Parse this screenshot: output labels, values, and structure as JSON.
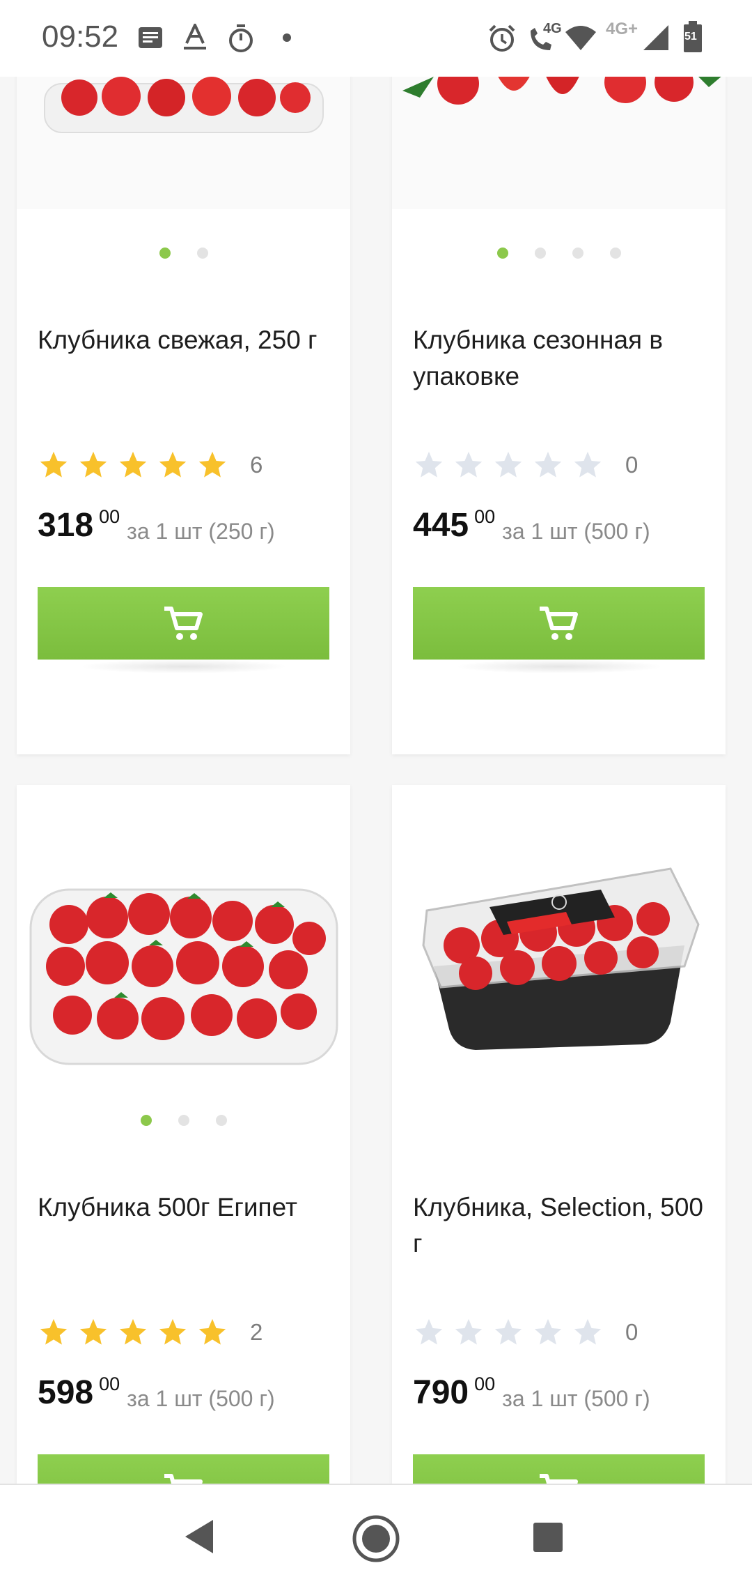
{
  "status_bar": {
    "time": "09:52",
    "icons": [
      "news-icon",
      "font-a-icon",
      "timer-icon",
      "dot-icon",
      "alarm-icon",
      "volte-4g-call-icon",
      "wifi-icon",
      "signal-4g-plus-icon",
      "battery-icon"
    ],
    "network_label": "4G+",
    "call_label": "4G",
    "battery_level": "51"
  },
  "products": [
    {
      "title": "Клубника свежая, 250 г",
      "rating_count": "6",
      "rating_stars": 5,
      "price_main": "318",
      "price_cents": "00",
      "price_unit": "за 1 шт (250 г)",
      "image_count": 2,
      "active_image": 0,
      "cart_icon": "cart-icon"
    },
    {
      "title": "Клубника сезонная в упаковке",
      "rating_count": "0",
      "rating_stars": 0,
      "price_main": "445",
      "price_cents": "00",
      "price_unit": "за 1 шт (500 г)",
      "image_count": 4,
      "active_image": 0,
      "cart_icon": "cart-icon"
    },
    {
      "title": "Клубника 500г Египет",
      "rating_count": "2",
      "rating_stars": 5,
      "price_main": "598",
      "price_cents": "00",
      "price_unit": "за 1 шт (500 г)",
      "image_count": 3,
      "active_image": 0,
      "cart_icon": "cart-icon"
    },
    {
      "title": "Клубника, Selection, 500 г",
      "rating_count": "0",
      "rating_stars": 0,
      "price_main": "790",
      "price_cents": "00",
      "price_unit": "за 1 шт (500 г)",
      "image_count": 1,
      "active_image": 0,
      "cart_icon": "cart-icon"
    }
  ],
  "colors": {
    "accent_green": "#8cc84b",
    "star_filled": "#f8c12b",
    "star_empty": "#dfe4ec"
  },
  "nav_bar": {
    "icons": [
      "back-icon",
      "home-icon",
      "recents-icon"
    ]
  }
}
